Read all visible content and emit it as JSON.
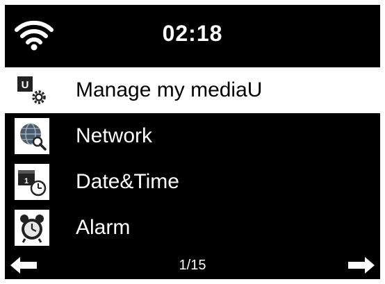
{
  "status": {
    "time": "02:18",
    "wifi_icon": "wifi-icon"
  },
  "menu": {
    "items": [
      {
        "label": "Manage my mediaU",
        "icon": "mediau-settings-icon",
        "selected": true
      },
      {
        "label": "Network",
        "icon": "network-globe-icon",
        "selected": false
      },
      {
        "label": "Date&Time",
        "icon": "calendar-clock-icon",
        "selected": false
      },
      {
        "label": "Alarm",
        "icon": "alarm-clock-icon",
        "selected": false
      }
    ]
  },
  "footer": {
    "page": "1/15",
    "left_icon": "arrow-left-icon",
    "right_icon": "arrow-right-icon"
  },
  "colors": {
    "background": "#000000",
    "selected_background": "#ffffff",
    "text": "#ffffff"
  }
}
